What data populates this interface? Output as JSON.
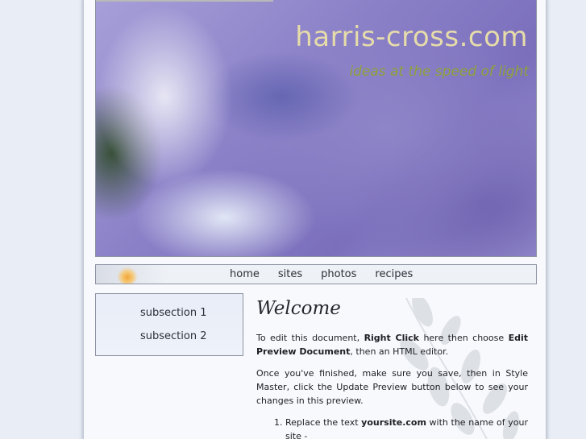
{
  "header": {
    "site_title": "harris-cross.com",
    "tagline": "ideas at the speed of light"
  },
  "nav": {
    "items": [
      {
        "label": "home"
      },
      {
        "label": "sites"
      },
      {
        "label": "photos"
      },
      {
        "label": "recipes"
      }
    ]
  },
  "sidebar": {
    "items": [
      {
        "label": "subsection 1"
      },
      {
        "label": "subsection 2"
      }
    ]
  },
  "main": {
    "heading": "Welcome",
    "para1": {
      "t1": "To edit this document, ",
      "b1": "Right Click",
      "t2": " here then choose ",
      "b2": "Edit Preview Document",
      "t3": ", then an HTML editor."
    },
    "para2": "Once you've finished, make sure you save, then in Style Master, click the Update Preview button below to see your changes in this preview.",
    "list": [
      {
        "t1": "Replace the text ",
        "b1": "yoursite.com",
        "t2": " with the name of your site -"
      }
    ]
  },
  "colors": {
    "page_background": "#e9eef6",
    "content_background": "#f7f9fc",
    "title_color": "#e6dcaa",
    "tagline_color": "#8fa23a",
    "text_color": "#1e1f24"
  }
}
